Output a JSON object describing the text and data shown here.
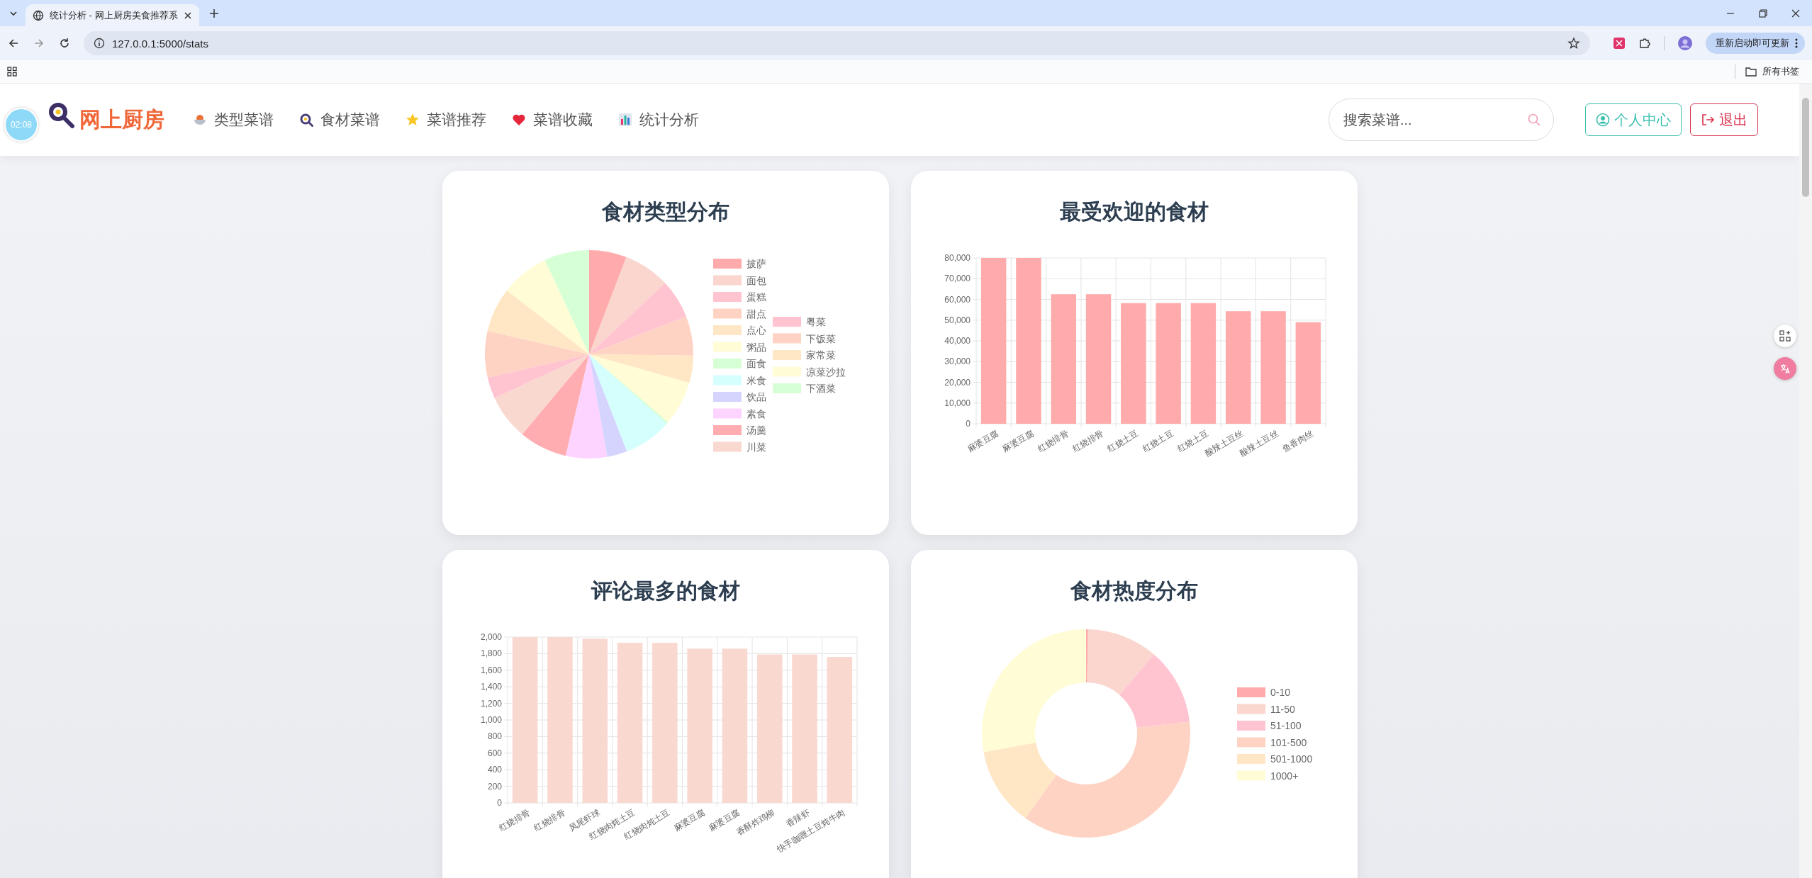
{
  "browser": {
    "tab_title": "统计分析 - 网上厨房美食推荐系",
    "address": "127.0.0.1:5000/stats",
    "update_button": "重新启动即可更新",
    "bookmarks_label": "所有书签"
  },
  "header": {
    "clock": "02:08",
    "site_title": "网上厨房",
    "nav": [
      {
        "label": "类型菜谱"
      },
      {
        "label": "食材菜谱"
      },
      {
        "label": "菜谱推荐"
      },
      {
        "label": "菜谱收藏"
      },
      {
        "label": "统计分析"
      }
    ],
    "search": {
      "placeholder": "搜索菜谱..."
    },
    "buttons": [
      {
        "kind": "profile",
        "label": "个人中心"
      },
      {
        "kind": "logout",
        "label": "退出"
      }
    ]
  },
  "cards": [
    {
      "chart_data": {
        "type": "pie",
        "title": "食材类型分布",
        "categories": [
          "披萨",
          "面包",
          "蛋糕",
          "甜点",
          "点心",
          "粥品",
          "面食",
          "米食",
          "饮品",
          "素食",
          "汤羹",
          "川菜",
          "粤菜",
          "下饭菜",
          "家常菜",
          "凉菜沙拉",
          "下酒菜"
        ],
        "values": [
          5.8,
          7.2,
          6.1,
          6.1,
          4.2,
          6.9,
          0.3,
          7.5,
          3.1,
          6.4,
          7.5,
          7.0,
          3.3,
          7.2,
          6.9,
          7.5,
          7.0
        ],
        "legend": "right",
        "colors": [
          "#ffabab",
          "#fad6cf",
          "#ffc4d0",
          "#ffd3c4",
          "#ffe6c4",
          "#fffcd6",
          "#d6ffd6",
          "#d4fffd",
          "#d4d4ff",
          "#fdd4ff",
          "#ffadb0",
          "#f9d8d0",
          "#ffc4d0",
          "#ffd3c4",
          "#ffe6c4",
          "#fffcd6",
          "#d6ffd6"
        ]
      }
    },
    {
      "chart_data": {
        "type": "bar",
        "title": "最受欢迎的食材",
        "categories": [
          "麻婆豆腐",
          "麻婆豆腐",
          "红烧排骨",
          "红烧排骨",
          "红烧土豆",
          "红烧土豆",
          "红烧土豆",
          "酸辣土豆丝",
          "酸辣土豆丝",
          "鱼香肉丝"
        ],
        "series": [
          {
            "color": "#ffabab",
            "values": [
              80000,
              80000,
              62500,
              62500,
              58200,
              58200,
              58200,
              54300,
              54300,
              49000
            ]
          }
        ],
        "grid": true,
        "ylim": [
          0,
          80000
        ],
        "yticks": [
          {
            "value": 0,
            "label": "0"
          },
          {
            "value": 10000,
            "label": "10,000"
          },
          {
            "value": 20000,
            "label": "20,000"
          },
          {
            "value": 30000,
            "label": "30,000"
          },
          {
            "value": 40000,
            "label": "40,000"
          },
          {
            "value": 50000,
            "label": "50,000"
          },
          {
            "value": 60000,
            "label": "60,000"
          },
          {
            "value": 70000,
            "label": "70,000"
          },
          {
            "value": 80000,
            "label": "80,000"
          }
        ]
      }
    },
    {
      "chart_data": {
        "type": "bar",
        "title": "评论最多的食材",
        "categories": [
          "红烧排骨",
          "红烧排骨",
          "凤尾虾球",
          "红烧肉炖土豆",
          "红烧肉炖土豆",
          "麻婆豆腐",
          "麻婆豆腐",
          "香酥炸鸡柳",
          "香辣虾",
          "快手咖喱土豆炖牛肉"
        ],
        "series": [
          {
            "color": "#f9d8d0",
            "values": [
              2000,
              2000,
              1980,
              1930,
              1930,
              1860,
              1860,
              1790,
              1790,
              1760
            ]
          }
        ],
        "grid": true,
        "ylim": [
          0,
          2000
        ],
        "yticks": [
          {
            "value": 0,
            "label": "0"
          },
          {
            "value": 200,
            "label": "200"
          },
          {
            "value": 400,
            "label": "400"
          },
          {
            "value": 600,
            "label": "600"
          },
          {
            "value": 800,
            "label": "800"
          },
          {
            "value": 1000,
            "label": "1,000"
          },
          {
            "value": 1200,
            "label": "1,200"
          },
          {
            "value": 1400,
            "label": "1,400"
          },
          {
            "value": 1600,
            "label": "1,600"
          },
          {
            "value": 1800,
            "label": "1,800"
          },
          {
            "value": 2000,
            "label": "2,000"
          }
        ]
      }
    },
    {
      "chart_data": {
        "type": "donut",
        "title": "食材热度分布",
        "categories": [
          "0-10",
          "11-50",
          "51-100",
          "101-500",
          "501-1000",
          "1000+"
        ],
        "values": [
          0.3,
          11,
          11.9,
          36.7,
          12.2,
          27.9
        ],
        "legend": "right",
        "colors": [
          "#ffabab",
          "#fad6cf",
          "#ffc4d0",
          "#ffd3c4",
          "#ffe6c4",
          "#fffcd6"
        ]
      }
    }
  ]
}
